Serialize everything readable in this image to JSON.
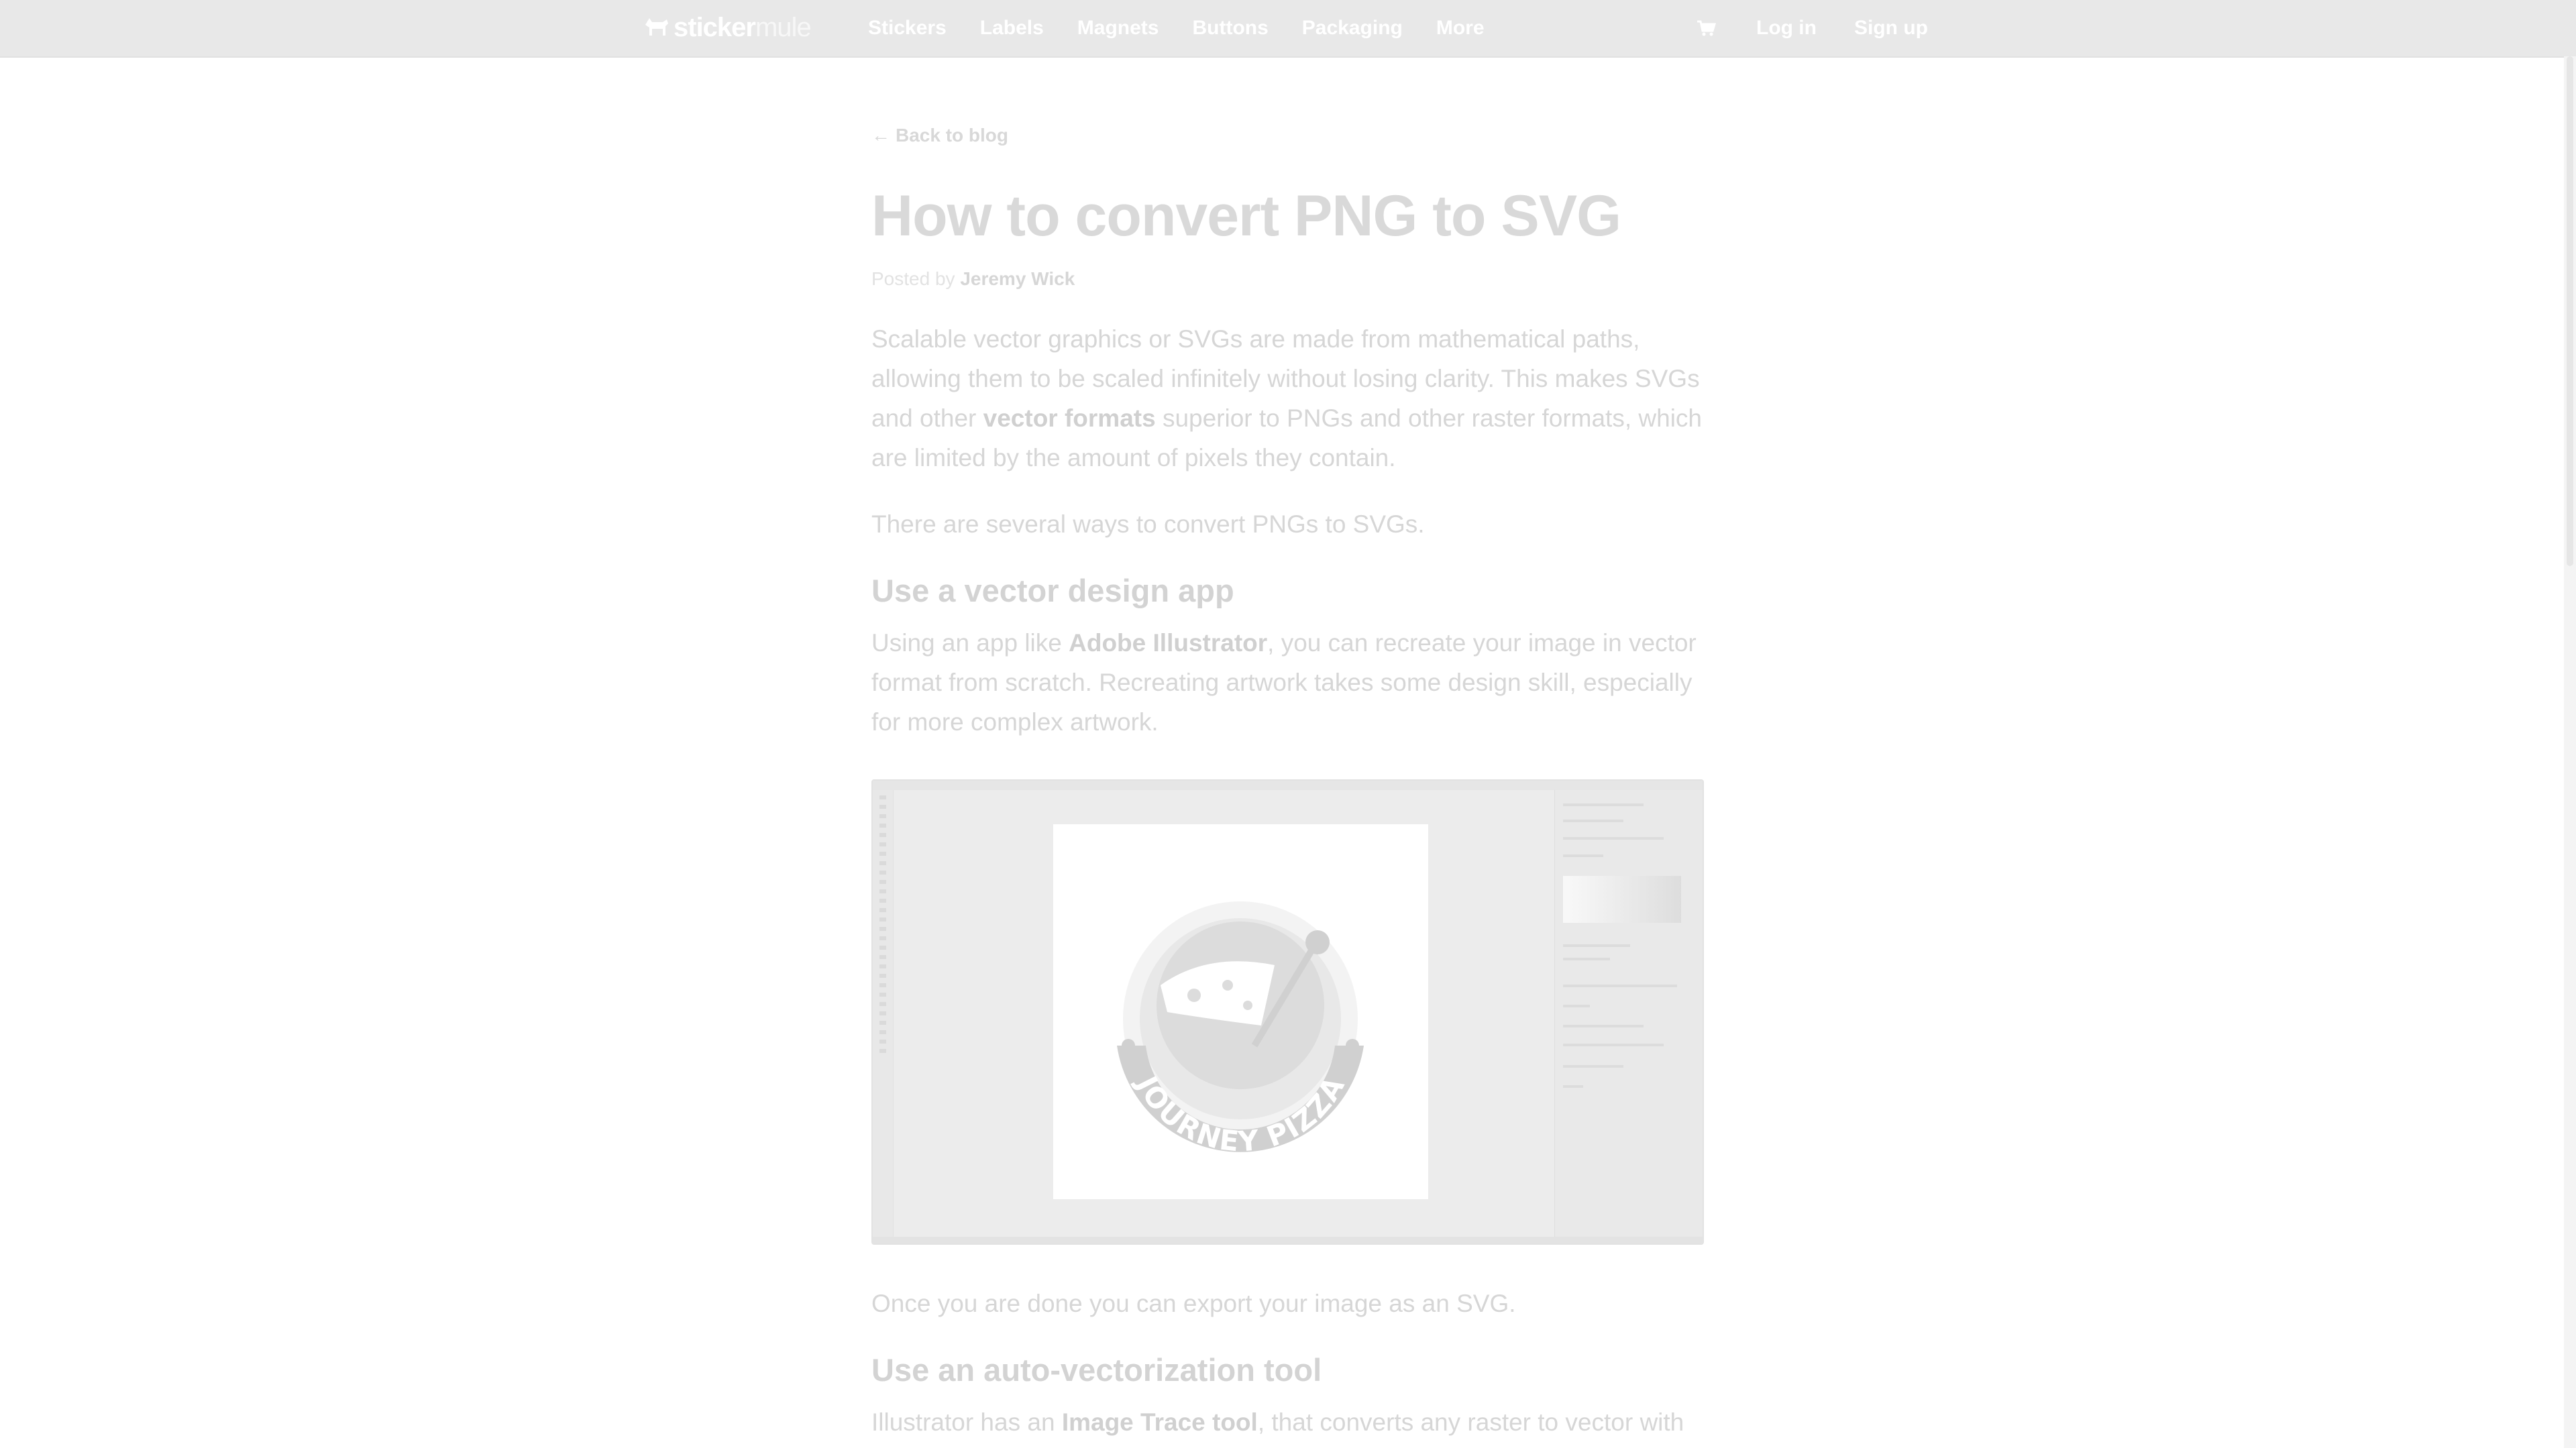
{
  "brand": {
    "name_bold": "sticker",
    "name_light": "mule"
  },
  "nav": {
    "items": [
      "Stickers",
      "Labels",
      "Magnets",
      "Buttons",
      "Packaging",
      "More"
    ],
    "cart_icon": "cart-icon",
    "login": "Log in",
    "signup": "Sign up"
  },
  "article": {
    "back_link": "Back to blog",
    "title": "How to convert PNG to SVG",
    "posted_by_label": "Posted by",
    "author": "Jeremy Wick",
    "p1": {
      "a": "Scalable vector graphics or SVGs are made from mathematical paths, allowing them to be scaled infinitely without losing clarity. This makes SVGs and other ",
      "link": "vector formats",
      "b": " superior to PNGs and other raster formats, which are limited by the amount of pixels they contain."
    },
    "p2": "There are several ways to convert PNGs to SVGs.",
    "h2_1": "Use a vector design app",
    "p3": {
      "a": "Using an app like ",
      "link": "Adobe Illustrator",
      "b": ", you can recreate your image in vector format from scratch. Recreating artwork takes some design skill, especially for more complex artwork."
    },
    "figure_logo_text": "JOURNEY PIZZA",
    "p4": "Once you are done you can export your image as an SVG.",
    "h2_2": "Use an auto-vectorization tool",
    "p5": {
      "a": "Illustrator has an ",
      "link": "Image Trace tool",
      "b": ", that converts any raster to vector with"
    }
  },
  "colors": {
    "topbar": "#e8e8e8",
    "text_dimmed": "#d6d6d6"
  }
}
